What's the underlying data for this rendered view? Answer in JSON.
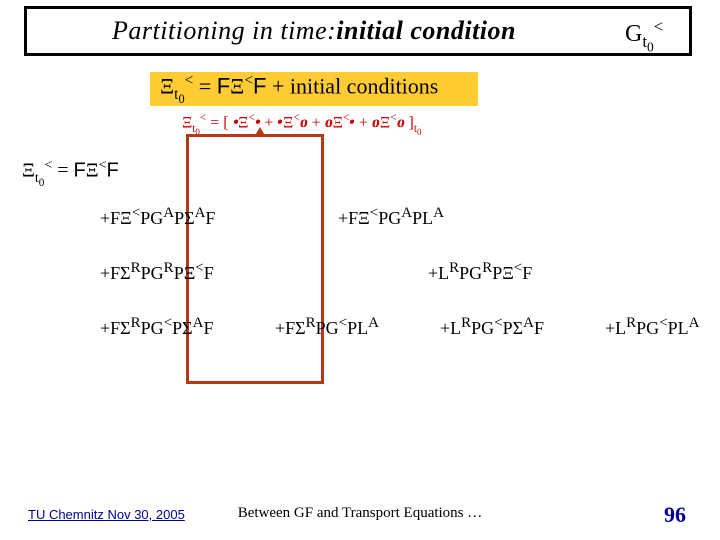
{
  "title": {
    "prefix": "Partitioning in time: ",
    "emph": "initial condition",
    "symbol_html": "G<span class='sub'>t<sub style=\"font-size:0.8em\">0</sub></span><span class='sup'>&lt;</span>"
  },
  "eq_main_html": "Ξ<span class='sub'>t<sub style=\"font-size:0.8em\">0</sub></span><span class='sup'>&lt;</span> = <span class='sans'>F</span>Ξ<span class='sup'>&lt;</span><span class='sans'>F</span> + initial conditions",
  "eq_red_html": "Ξ<span class='sub'>t<sub style=\"font-size:0.8em\">0</sub></span><span class='sup'>&lt;</span> = [ <span class='skew'>•</span>Ξ<span class='sup'>&lt;</span><span class='skew'>•</span> + <span class='skew'>•</span>Ξ<span class='sup'>&lt;</span><span class='skew'>о</span> + <span class='skew'>о</span>Ξ<span class='sup'>&lt;</span><span class='skew'>•</span> + <span class='skew'>о</span>Ξ<span class='sup'>&lt;</span><span class='skew'>о</span> ]<span class='sub'>t<sub style=\"font-size:0.8em\">0</sub></span>",
  "eq_xi_html": "Ξ<span class='sub'>t<sub style=\"font-size:0.8em\">0</sub></span><span class='sup'>&lt;</span> = <span class='sans'>F</span>Ξ<span class='sup'>&lt;</span><span class='sans'>F</span>",
  "rows": {
    "r1a": "+FΞ<sup>&lt;</sup>PG<sup>A</sup>PΣ<sup>A</sup>F",
    "r1b": "+FΞ<sup>&lt;</sup>PG<sup>A</sup>PL<sup>A</sup>",
    "r2a": "+FΣ<sup>R</sup>PG<sup>R</sup>PΞ<sup>&lt;</sup>F",
    "r2b": "+L<sup>R</sup>PG<sup>R</sup>PΞ<sup>&lt;</sup>F",
    "r3a": "+FΣ<sup>R</sup>PG<sup>&lt;</sup>PΣ<sup>A</sup>F",
    "r3b": "+FΣ<sup>R</sup>PG<sup>&lt;</sup>PL<sup>A</sup>",
    "r3c": "+L<sup>R</sup>PG<sup>&lt;</sup>PΣ<sup>A</sup>F",
    "r3d": "+L<sup>R</sup>PG<sup>&lt;</sup>PL<sup>A</sup>"
  },
  "footer": {
    "left": "TU Chemnitz Nov 30, 2005",
    "center": "Between GF and Transport Equations …",
    "page": "96"
  }
}
